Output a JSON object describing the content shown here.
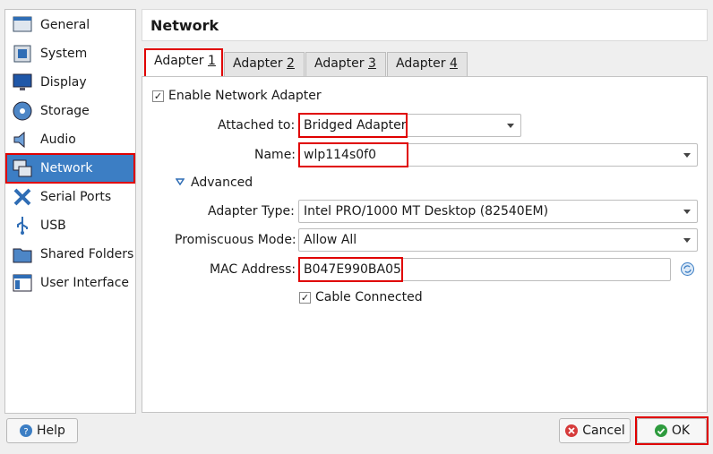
{
  "sidebar": {
    "items": [
      {
        "label": "General",
        "icon": "general-icon"
      },
      {
        "label": "System",
        "icon": "system-icon"
      },
      {
        "label": "Display",
        "icon": "display-icon"
      },
      {
        "label": "Storage",
        "icon": "storage-icon"
      },
      {
        "label": "Audio",
        "icon": "audio-icon"
      },
      {
        "label": "Network",
        "icon": "network-icon"
      },
      {
        "label": "Serial Ports",
        "icon": "serial-ports-icon"
      },
      {
        "label": "USB",
        "icon": "usb-icon"
      },
      {
        "label": "Shared Folders",
        "icon": "shared-folders-icon"
      },
      {
        "label": "User Interface",
        "icon": "user-interface-icon"
      }
    ],
    "selected": "Network"
  },
  "page": {
    "title": "Network"
  },
  "tabs": [
    {
      "label": "Adapter ",
      "accel": "1"
    },
    {
      "label": "Adapter ",
      "accel": "2"
    },
    {
      "label": "Adapter ",
      "accel": "3"
    },
    {
      "label": "Adapter ",
      "accel": "4"
    }
  ],
  "adapter": {
    "enable_label": "Enable Network Adapter",
    "attached_label": "Attached to:",
    "attached_value": "Bridged Adapter",
    "name_label": "Name:",
    "name_value": "wlp114s0f0",
    "advanced_label": "Advanced",
    "adapter_type_label": "Adapter Type:",
    "adapter_type_value": "Intel PRO/1000 MT Desktop (82540EM)",
    "promiscuous_label": "Promiscuous Mode:",
    "promiscuous_value": "Allow All",
    "mac_label": "MAC Address:",
    "mac_value": "B047E990BA05",
    "cable_label": "Cable Connected"
  },
  "buttons": {
    "help": "Help",
    "cancel": "Cancel",
    "ok": "OK"
  },
  "colors": {
    "highlight": "#e00000",
    "selection": "#3c7ec4"
  }
}
